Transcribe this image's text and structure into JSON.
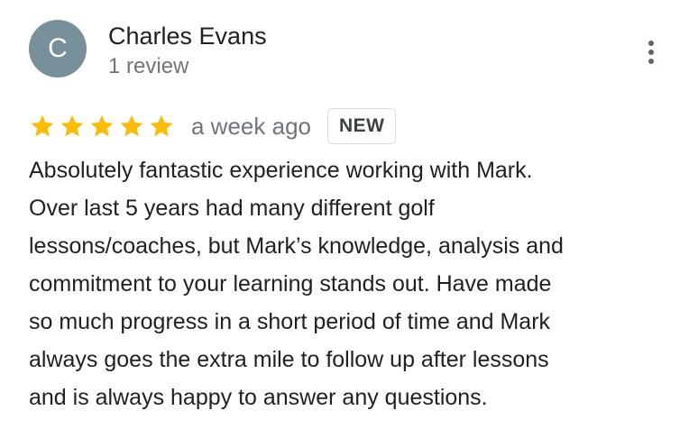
{
  "author": {
    "initial": "C",
    "name": "Charles Evans",
    "review_count": "1 review",
    "avatar_color": "#78909c"
  },
  "menu": {
    "icon": "more-vert-icon"
  },
  "review": {
    "rating": 5,
    "max_rating": 5,
    "star_color": "#fbbc04",
    "time_ago": "a week ago",
    "badge": "NEW",
    "text": "Absolutely fantastic experience working with Mark.\nOver last 5 years had many different golf\nlessons/coaches, but Mark’s knowledge, analysis and\ncommitment to your learning stands out. Have made\nso much progress in a short period of time and Mark\nalways goes the extra mile to follow up after lessons\nand is always happy to answer any questions."
  }
}
